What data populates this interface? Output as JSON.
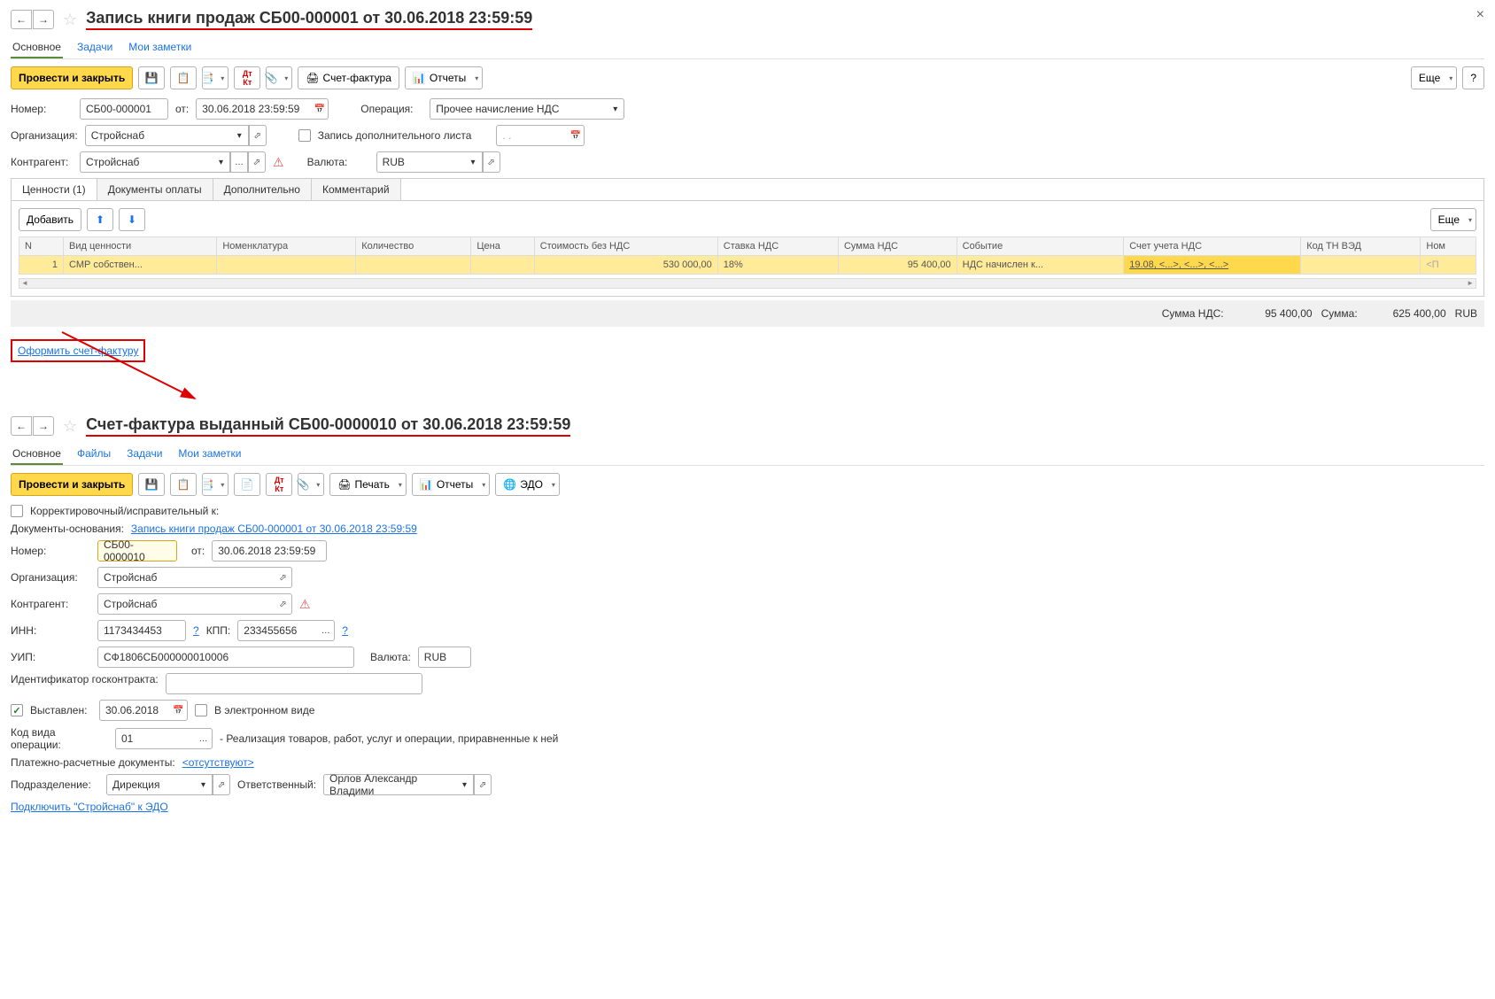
{
  "doc1": {
    "title": "Запись книги продаж СБ00-000001 от 30.06.2018 23:59:59",
    "navtabs": [
      "Основное",
      "Задачи",
      "Мои заметки"
    ],
    "toolbar": {
      "post_close": "Провести и закрыть",
      "invoice": "Счет-фактура",
      "reports": "Отчеты",
      "more": "Еще",
      "help": "?"
    },
    "fields": {
      "number_label": "Номер:",
      "number": "СБ00-000001",
      "date_label": "от:",
      "date": "30.06.2018 23:59:59",
      "operation_label": "Операция:",
      "operation": "Прочее начисление НДС",
      "org_label": "Организация:",
      "org": "Стройснаб",
      "extra_sheet_label": "Запись дополнительного листа",
      "extra_sheet_date": ". .",
      "counterparty_label": "Контрагент:",
      "counterparty": "Стройснаб",
      "currency_label": "Валюта:",
      "currency": "RUB"
    },
    "tabs": [
      "Ценности (1)",
      "Документы оплаты",
      "Дополнительно",
      "Комментарий"
    ],
    "add_btn": "Добавить",
    "more2": "Еще",
    "table": {
      "headers": [
        "N",
        "Вид ценности",
        "Номенклатура",
        "Количество",
        "Цена",
        "Стоимость без НДС",
        "Ставка НДС",
        "Сумма НДС",
        "Событие",
        "Счет учета НДС",
        "Код ТН ВЭД",
        "Ном"
      ],
      "row": {
        "n": "1",
        "type": "СМР собствен...",
        "nomenclature": "",
        "qty": "",
        "price": "",
        "cost": "530 000,00",
        "rate": "18%",
        "vat": "95 400,00",
        "event": "НДС начислен к...",
        "account": "19.08, <...>, <...>, <...>",
        "tnved": "",
        "nom": "<П"
      }
    },
    "totals": {
      "vat_label": "Сумма НДС:",
      "vat": "95 400,00",
      "sum_label": "Сумма:",
      "sum": "625 400,00",
      "cur": "RUB"
    },
    "create_invoice": "Оформить счет-фактуру"
  },
  "doc2": {
    "title": "Счет-фактура выданный СБ00-0000010 от 30.06.2018 23:59:59",
    "navtabs": [
      "Основное",
      "Файлы",
      "Задачи",
      "Мои заметки"
    ],
    "toolbar": {
      "post_close": "Провести и закрыть",
      "print": "Печать",
      "reports": "Отчеты",
      "edo": "ЭДО"
    },
    "fields": {
      "corr_label": "Корректировочный/исправительный к:",
      "basis_label": "Документы-основания:",
      "basis_link": "Запись книги продаж СБ00-000001 от 30.06.2018 23:59:59",
      "number_label": "Номер:",
      "number": "СБ00-0000010",
      "date_label": "от:",
      "date": "30.06.2018 23:59:59",
      "org_label": "Организация:",
      "org": "Стройснаб",
      "counterparty_label": "Контрагент:",
      "counterparty": "Стройснаб",
      "inn_label": "ИНН:",
      "inn": "1173434453",
      "kpp_label": "КПП:",
      "kpp": "233455656",
      "uip_label": "УИП:",
      "uip": "СФ1806СБ000000010006",
      "currency_label": "Валюта:",
      "currency": "RUB",
      "goscontract_label": "Идентификатор госконтракта:",
      "issued_label": "Выставлен:",
      "issued_date": "30.06.2018",
      "electronic_label": "В электронном виде",
      "opcode_label": "Код вида операции:",
      "opcode": "01",
      "opcode_desc": "- Реализация товаров, работ, услуг и операции, приравненные к ней",
      "payment_docs_label": "Платежно-расчетные документы:",
      "payment_docs_link": "<отсутствуют>",
      "dept_label": "Подразделение:",
      "dept": "Дирекция",
      "resp_label": "Ответственный:",
      "resp": "Орлов Александр Владими",
      "edo_link": "Подключить \"Стройснаб\" к ЭДО"
    }
  }
}
